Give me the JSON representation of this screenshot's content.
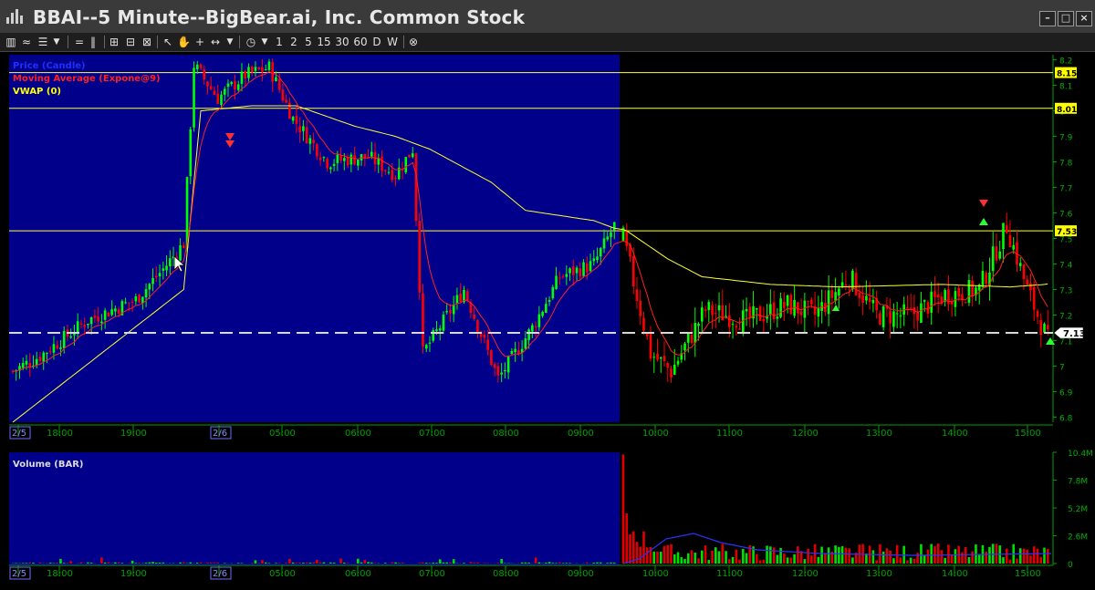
{
  "window": {
    "title": "BBAI--5 Minute--BigBear.ai, Inc. Common Stock",
    "buttons": [
      "–",
      "□",
      "×"
    ]
  },
  "toolbar": {
    "tools": [
      "bar-chart-icon",
      "indicator-icon",
      "list-icon",
      "dropdown-icon",
      "equals-icon",
      "parallel-icon",
      "zoom-in-icon",
      "zoom-out-icon",
      "zoom-fit-icon",
      "pointer-icon",
      "hand-icon",
      "crosshair-icon",
      "horizontal-line-icon",
      "dropdown-icon",
      "clock-icon",
      "dropdown-icon"
    ],
    "intervals": [
      "1",
      "2",
      "5",
      "15",
      "30",
      "60",
      "D",
      "W"
    ],
    "close_glyph": "⊗"
  },
  "price_panel": {
    "legend": [
      {
        "label": "Price (Candle)",
        "color": "#0000ff"
      },
      {
        "label": "Moving Average (Expone@9)",
        "color": "#ff2020"
      },
      {
        "label": "VWAP (0)",
        "color": "#ffff00"
      }
    ],
    "y_ticks": [
      "8.2",
      "8.1",
      "8",
      "7.9",
      "7.8",
      "7.7",
      "7.6",
      "7.5",
      "7.4",
      "7.3",
      "7.2",
      "7.1",
      "7",
      "6.9",
      "6.8"
    ],
    "price_lines": [
      {
        "label": "8.15",
        "value": 8.15
      },
      {
        "label": "8.01",
        "value": 8.01
      },
      {
        "label": "7.53",
        "value": 7.53
      }
    ],
    "last_price": {
      "label": "7.13",
      "value": 7.13
    },
    "bg_premarket": "#00008b",
    "bg_session": "#000000",
    "up_color": "#00ff00",
    "down_color": "#ff0000"
  },
  "volume_panel": {
    "title": "Volume (BAR)",
    "y_ticks": [
      "10.4M",
      "7.8M",
      "5.2M",
      "2.6M",
      "0"
    ]
  },
  "time_axis": {
    "labels": [
      "2/5",
      "18:00",
      "19:00",
      "2/6",
      "05:00",
      "06:00",
      "07:00",
      "08:00",
      "09:00",
      "10:00",
      "11:00",
      "12:00",
      "13:00",
      "14:00",
      "15:00"
    ]
  },
  "chart_data": {
    "type": "candlestick",
    "symbol": "BBAI",
    "interval": "5 Minute",
    "ylim": [
      6.78,
      8.22
    ],
    "volume_ylim": [
      0,
      10400000
    ],
    "grid": false,
    "segments": [
      {
        "name": "premarket",
        "anchors": [
          [
            0,
            6.98
          ],
          [
            8,
            7.04
          ],
          [
            22,
            7.18
          ],
          [
            36,
            7.26
          ],
          [
            44,
            7.38
          ],
          [
            50,
            7.48
          ],
          [
            53,
            8.18
          ],
          [
            60,
            8.05
          ],
          [
            68,
            8.14
          ],
          [
            75,
            8.17
          ],
          [
            82,
            7.97
          ],
          [
            92,
            7.8
          ],
          [
            104,
            7.82
          ],
          [
            112,
            7.75
          ],
          [
            117,
            7.85
          ],
          [
            120,
            7.05
          ],
          [
            132,
            7.3
          ],
          [
            142,
            6.95
          ],
          [
            152,
            7.15
          ],
          [
            160,
            7.35
          ],
          [
            170,
            7.4
          ],
          [
            176,
            7.55
          ]
        ]
      },
      {
        "name": "regular",
        "anchors": [
          [
            0,
            7.5
          ],
          [
            8,
            7.05
          ],
          [
            14,
            6.98
          ],
          [
            24,
            7.22
          ],
          [
            36,
            7.18
          ],
          [
            48,
            7.24
          ],
          [
            56,
            7.2
          ],
          [
            66,
            7.35
          ],
          [
            74,
            7.2
          ],
          [
            84,
            7.2
          ],
          [
            94,
            7.28
          ],
          [
            104,
            7.3
          ],
          [
            112,
            7.55
          ],
          [
            118,
            7.3
          ],
          [
            124,
            7.1
          ]
        ]
      }
    ],
    "vwap_anchors": [
      [
        0,
        6.78
      ],
      [
        50,
        7.3
      ],
      [
        55,
        8.0
      ],
      [
        70,
        8.02
      ],
      [
        83,
        8.02
      ],
      [
        100,
        7.94
      ],
      [
        112,
        7.9
      ],
      [
        122,
        7.85
      ],
      [
        140,
        7.72
      ],
      [
        150,
        7.61
      ],
      [
        170,
        7.57
      ],
      [
        178,
        7.53
      ],
      [
        190,
        7.42
      ],
      [
        200,
        7.35
      ],
      [
        220,
        7.32
      ],
      [
        240,
        7.31
      ],
      [
        270,
        7.32
      ],
      [
        290,
        7.31
      ],
      [
        300,
        7.32
      ]
    ],
    "ema_period": 9
  }
}
